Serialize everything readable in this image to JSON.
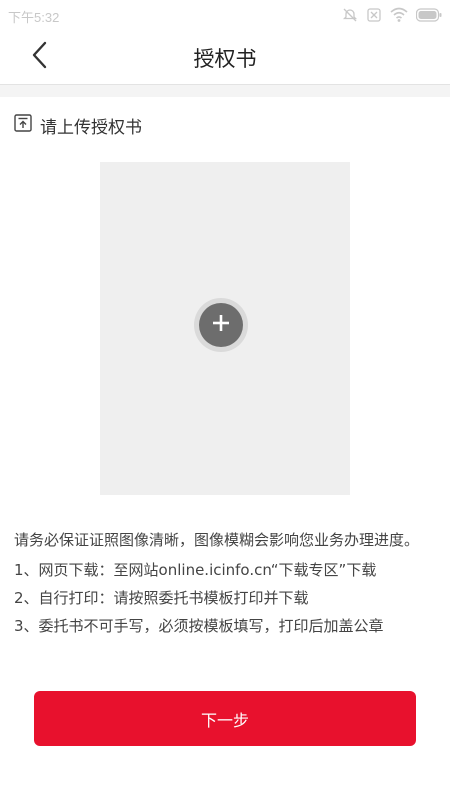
{
  "status_bar": {
    "time": "下午5:32",
    "icons": [
      "alarm-off-icon",
      "sim-none-icon",
      "wifi-icon",
      "battery-icon"
    ]
  },
  "header": {
    "title": "授权书",
    "back_icon": "chevron-left-icon"
  },
  "upload": {
    "icon": "upload-icon",
    "label": "请上传授权书",
    "add_icon": "plus-icon"
  },
  "notes": {
    "intro": "请务必保证证照图像清晰，图像模糊会影响您业务办理进度。",
    "items": [
      "1、网页下载：至网站online.icinfo.cn“下载专区”下载",
      "2、自行打印：请按照委托书模板打印并下载",
      "3、委托书不可手写，必须按模板填写，打印后加盖公章"
    ]
  },
  "footer": {
    "next_label": "下一步"
  },
  "colors": {
    "accent": "#e8112d",
    "upload_bg": "#efefef",
    "separator": "#f4f4f4"
  }
}
